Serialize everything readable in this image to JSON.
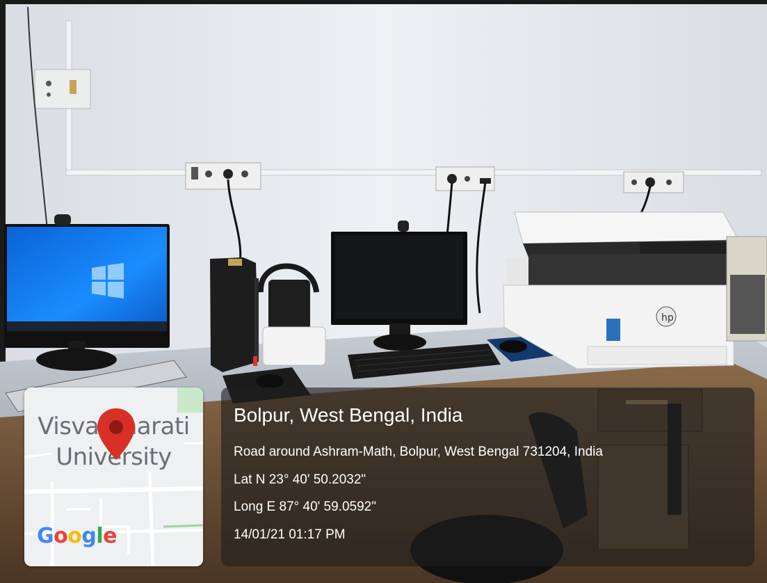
{
  "map": {
    "label_line1": "Visva-Bharati",
    "label_line2": "University",
    "google_letters": [
      {
        "ch": "G",
        "color": "#4285F4"
      },
      {
        "ch": "o",
        "color": "#EA4335"
      },
      {
        "ch": "o",
        "color": "#FBBC05"
      },
      {
        "ch": "g",
        "color": "#4285F4"
      },
      {
        "ch": "l",
        "color": "#34A853"
      },
      {
        "ch": "e",
        "color": "#EA4335"
      }
    ],
    "pin_color": "#D93025"
  },
  "location": {
    "title": "Bolpur, West Bengal, India",
    "address": "Road around Ashram-Math, Bolpur, West Bengal 731204, India",
    "lat": "Lat N 23° 40' 50.2032\"",
    "long": "Long E 87° 40' 59.0592\"",
    "timestamp": "14/01/21 01:17 PM"
  }
}
